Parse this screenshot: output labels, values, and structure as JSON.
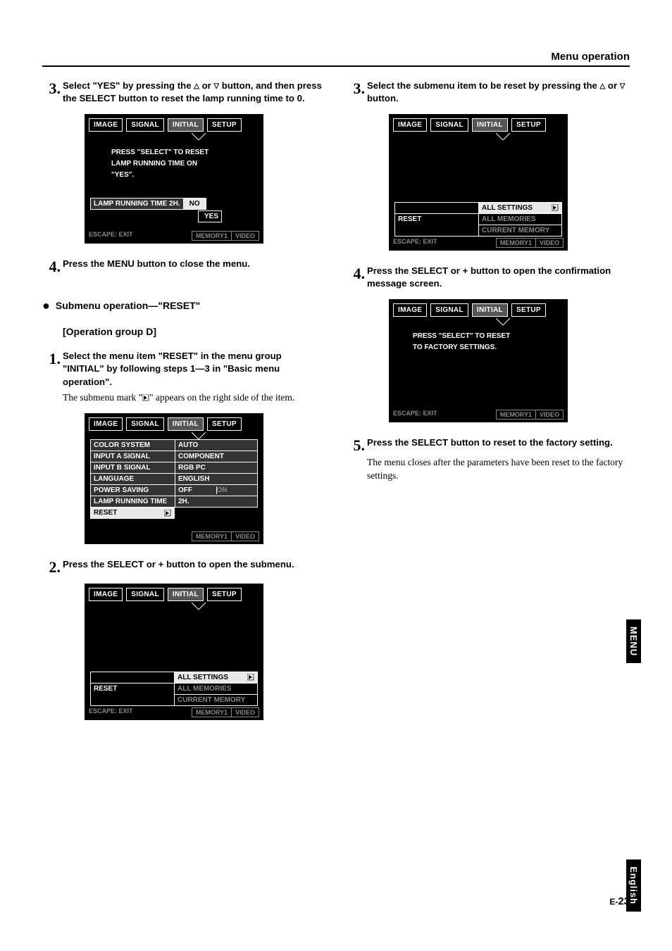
{
  "header": "Menu operation",
  "side_tab_menu": "MENU",
  "side_tab_english": "English",
  "page_num_prefix": "E-",
  "page_num": "23",
  "left": {
    "step3_num": "3.",
    "step3_text_1": "Select \"YES\" by pressing the ",
    "step3_text_2": " or ",
    "step3_text_3": " button, and then press the SELECT button to reset the lamp running time to 0.",
    "osd1": {
      "tabs": [
        "IMAGE",
        "SIGNAL",
        "INITIAL",
        "SETUP"
      ],
      "msg1": "PRESS \"SELECT\" TO RESET",
      "msg2": "LAMP RUNNING TIME ON",
      "msg3": "\"YES\".",
      "lamp_label": "LAMP RUNNING TIME 2H.",
      "no": "NO",
      "yes": "YES",
      "escape": "ESCAPE: EXIT",
      "mem": "MEMORY1",
      "vid": "VIDEO"
    },
    "step4_num": "4.",
    "step4_text": "Press the MENU button to close the menu.",
    "subhead": "Submenu operation—\"RESET\"",
    "op_group": "[Operation group D]",
    "d1_num": "1.",
    "d1_text": "Select the menu item \"RESET\" in the menu group \"INITIAL\" by following steps 1—3 in \"Basic menu operation\".",
    "d1_note_1": "The submenu mark \"",
    "d1_note_2": "\" appears on the right side of the item.",
    "osd2": {
      "tabs": [
        "IMAGE",
        "SIGNAL",
        "INITIAL",
        "SETUP"
      ],
      "rows": [
        {
          "l": "COLOR SYSTEM",
          "r": "AUTO"
        },
        {
          "l": "INPUT A SIGNAL",
          "r": "COMPONENT"
        },
        {
          "l": "INPUT B SIGNAL",
          "r": "RGB PC"
        },
        {
          "l": "LANGUAGE",
          "r": "ENGLISH"
        },
        {
          "l": "POWER SAVING",
          "r": "OFF",
          "r2": "ON"
        },
        {
          "l": "LAMP RUNNING TIME",
          "r": "2H."
        }
      ],
      "reset": "RESET",
      "escape": "",
      "mem": "MEMORY1",
      "vid": "VIDEO"
    },
    "d2_num": "2.",
    "d2_text": "Press the SELECT or + button to open the submenu.",
    "osd3": {
      "tabs": [
        "IMAGE",
        "SIGNAL",
        "INITIAL",
        "SETUP"
      ],
      "reset": "RESET",
      "sub": [
        "ALL SETTINGS",
        "ALL MEMORIES",
        "CURRENT MEMORY"
      ],
      "escape": "ESCAPE: EXIT",
      "mem": "MEMORY1",
      "vid": "VIDEO"
    }
  },
  "right": {
    "r3_num": "3.",
    "r3_text_1": "Select the submenu item to be reset by pressing the ",
    "r3_text_2": " or ",
    "r3_text_3": " button.",
    "osd4": {
      "tabs": [
        "IMAGE",
        "SIGNAL",
        "INITIAL",
        "SETUP"
      ],
      "reset": "RESET",
      "sub": [
        "ALL SETTINGS",
        "ALL MEMORIES",
        "CURRENT MEMORY"
      ],
      "escape": "ESCAPE: EXIT",
      "mem": "MEMORY1",
      "vid": "VIDEO"
    },
    "r4_num": "4.",
    "r4_text": "Press the SELECT or + button to open the confirmation message screen.",
    "osd5": {
      "tabs": [
        "IMAGE",
        "SIGNAL",
        "INITIAL",
        "SETUP"
      ],
      "msg1": "PRESS \"SELECT\" TO RESET",
      "msg2": "TO FACTORY SETTINGS.",
      "escape": "ESCAPE: EXIT",
      "mem": "MEMORY1",
      "vid": "VIDEO"
    },
    "r5_num": "5.",
    "r5_text": "Press the SELECT button to reset to the factory setting.",
    "r5_note": "The menu closes after the parameters have been reset to the factory settings."
  }
}
